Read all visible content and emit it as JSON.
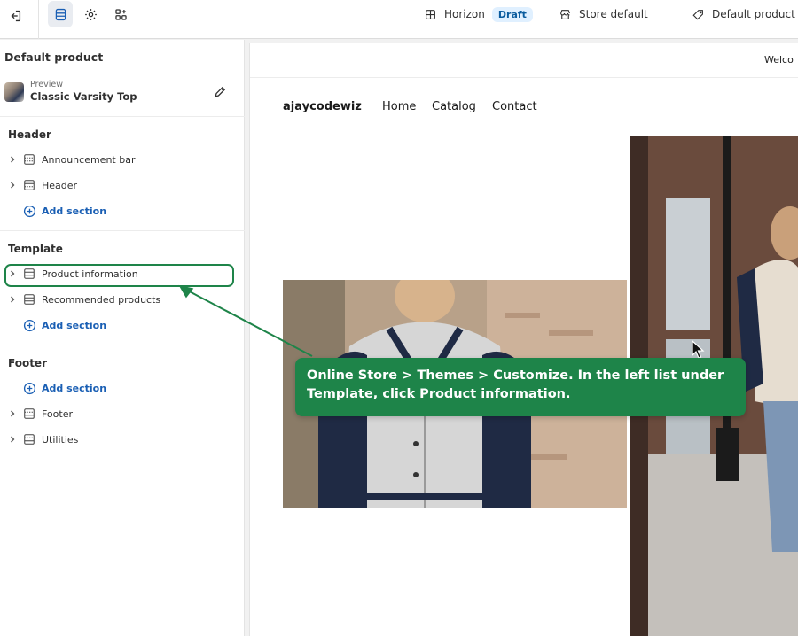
{
  "topbar": {
    "theme_name": "Horizon",
    "theme_status": "Draft",
    "store": "Store default",
    "template": "Default product"
  },
  "sidebar": {
    "title": "Default product",
    "preview": {
      "label": "Preview",
      "value": "Classic Varsity Top"
    },
    "groups": {
      "header": {
        "title": "Header",
        "items": [
          "Announcement bar",
          "Header"
        ],
        "add_label": "Add section"
      },
      "template": {
        "title": "Template",
        "items": [
          "Product information",
          "Recommended products"
        ],
        "add_label": "Add section"
      },
      "footer": {
        "title": "Footer",
        "add_label": "Add section",
        "items": [
          "Footer",
          "Utilities"
        ]
      }
    }
  },
  "store_preview": {
    "welcome": "Welco",
    "brand": "ajaycodewiz",
    "nav": [
      "Home",
      "Catalog",
      "Contact"
    ]
  },
  "annotation": {
    "text": "Online Store > Themes > Customize. In the left list under Template, click Product information.",
    "color": "#1e8449"
  }
}
